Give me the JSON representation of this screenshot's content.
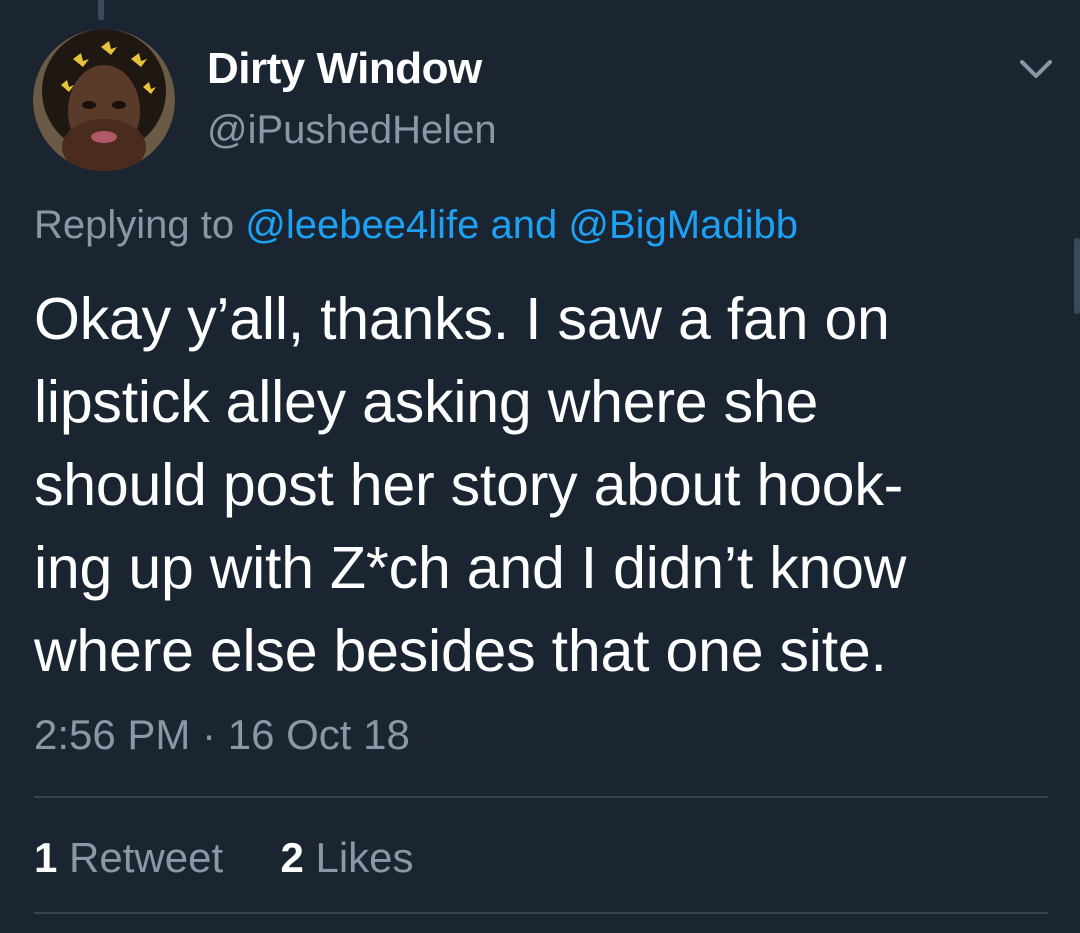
{
  "tweet": {
    "display_name": "Dirty Window",
    "handle": "@iPushedHelen",
    "reply": {
      "prefix": "Replying to",
      "mention_1": "@leebee4life",
      "conjunction": "and",
      "mention_2": "@BigMadibb"
    },
    "text_lines": [
      "Okay y’all, thanks. I saw a fan on",
      "lipstick alley asking where she",
      "should post her story about hook-",
      "ing up with Z*ch and I didn’t know",
      "where else besides that one site."
    ],
    "timestamp": "2:56 PM · 16 Oct 18",
    "stats": {
      "retweets_count": "1",
      "retweets_label": "Retweet",
      "likes_count": "2",
      "likes_label": "Likes"
    }
  },
  "icons": {
    "menu": "chevron-down-icon"
  },
  "colors": {
    "background": "#1b2532",
    "primary_text": "#ffffff",
    "secondary_text": "#8899a6",
    "link": "#1da1f2",
    "divider": "#38444d"
  }
}
